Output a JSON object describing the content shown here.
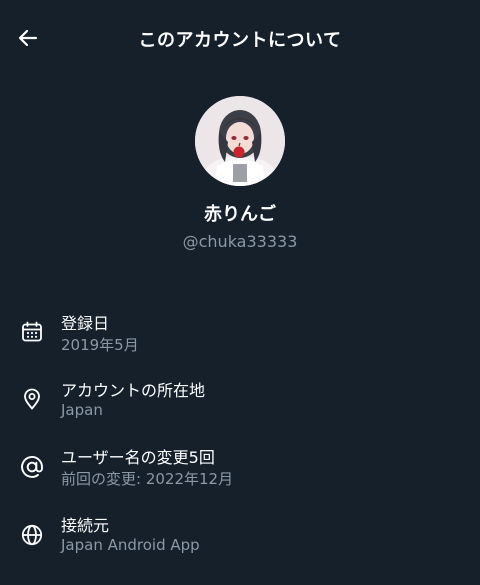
{
  "header": {
    "title": "このアカウントについて",
    "back_icon": "arrow-left-icon"
  },
  "profile": {
    "display_name": "赤りんご",
    "handle": "@chuka33333"
  },
  "info": [
    {
      "icon": "calendar-icon",
      "label": "登録日",
      "value": "2019年5月"
    },
    {
      "icon": "location-pin-icon",
      "label": "アカウントの所在地",
      "value": "Japan"
    },
    {
      "icon": "at-sign-icon",
      "label": "ユーザー名の変更5回",
      "value": "前回の変更: 2022年12月"
    },
    {
      "icon": "globe-icon",
      "label": "接続元",
      "value": "Japan Android App"
    }
  ],
  "colors": {
    "background": "#15202b",
    "text_primary": "#ffffff",
    "text_secondary": "#8b98a5"
  }
}
